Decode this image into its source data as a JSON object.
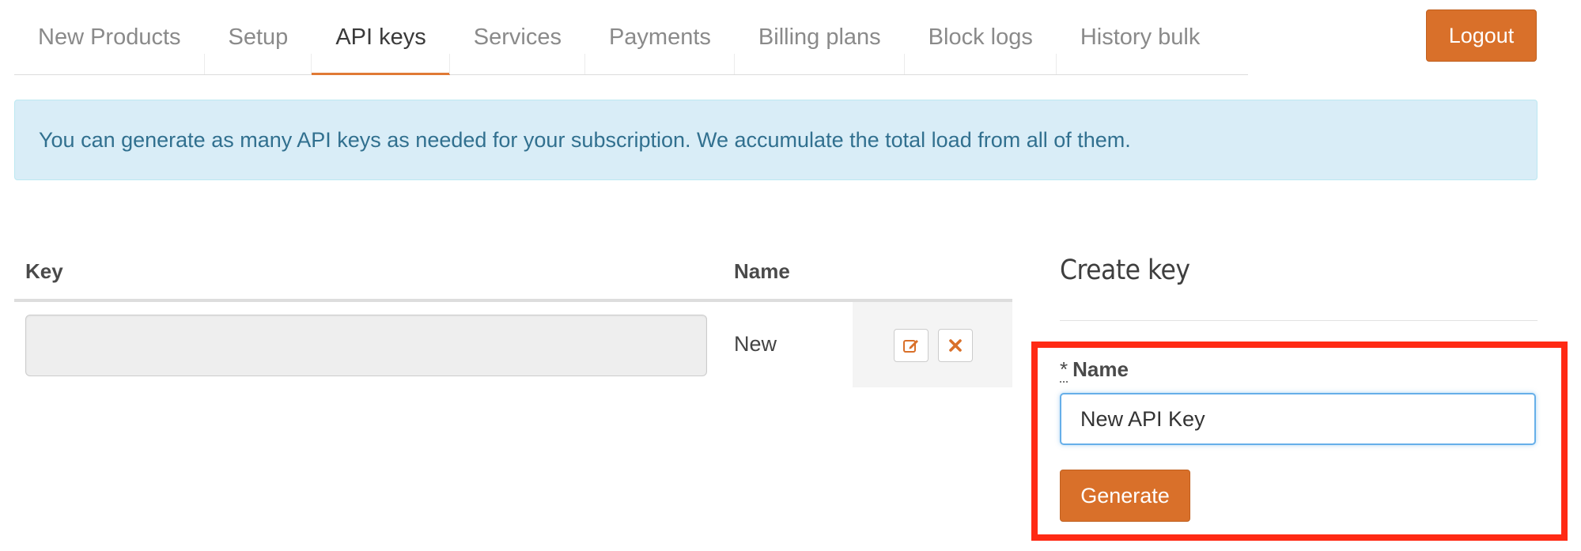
{
  "tabs": [
    {
      "label": "New Products",
      "active": false
    },
    {
      "label": "Setup",
      "active": false
    },
    {
      "label": "API keys",
      "active": true
    },
    {
      "label": "Services",
      "active": false
    },
    {
      "label": "Payments",
      "active": false
    },
    {
      "label": "Billing plans",
      "active": false
    },
    {
      "label": "Block logs",
      "active": false
    },
    {
      "label": "History bulk",
      "active": false
    }
  ],
  "header": {
    "logout_label": "Logout"
  },
  "alert": {
    "text": "You can generate as many API keys as needed for your subscription. We accumulate the total load from all of them."
  },
  "table": {
    "columns": {
      "key": "Key",
      "name": "Name"
    },
    "rows": [
      {
        "key": "",
        "name": "New"
      }
    ]
  },
  "create_key": {
    "title": "Create key",
    "required_marker": "*",
    "name_label": "Name",
    "name_value": "New API Key",
    "generate_label": "Generate"
  },
  "icons": {
    "edit": "edit-icon",
    "delete": "close-icon"
  },
  "colors": {
    "accent": "#d9702a",
    "alert_bg": "#d9edf7",
    "alert_text": "#31708f",
    "highlight": "#ff2a14"
  }
}
